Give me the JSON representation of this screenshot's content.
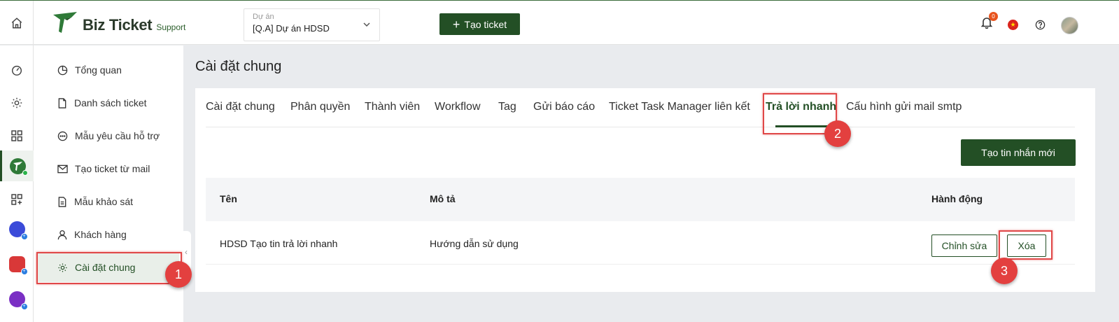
{
  "app": {
    "name": "Biz Ticket",
    "sub": "Support"
  },
  "project": {
    "label": "Dự án",
    "value": "[Q.A] Dự án HDSD"
  },
  "header": {
    "create_ticket": "Tạo ticket",
    "notification_count": "0"
  },
  "sidebar": {
    "items": [
      {
        "label": "Tổng quan",
        "icon": "pie-chart-icon"
      },
      {
        "label": "Danh sách ticket",
        "icon": "file-icon"
      },
      {
        "label": "Mẫu yêu cầu hỗ trợ",
        "icon": "chat-icon"
      },
      {
        "label": "Tạo ticket từ mail",
        "icon": "mail-icon"
      },
      {
        "label": "Mẫu khảo sát",
        "icon": "document-icon"
      },
      {
        "label": "Khách hàng",
        "icon": "user-icon"
      },
      {
        "label": "Cài đặt chung",
        "icon": "gear-icon",
        "active": true
      }
    ]
  },
  "page": {
    "title": "Cài đặt chung"
  },
  "tabs": [
    "Cài đặt chung",
    "Phân quyền",
    "Thành viên",
    "Workflow",
    "Tag",
    "Gửi báo cáo",
    "Ticket Task Manager liên kết",
    "Trả lời nhanh",
    "Cấu hình gửi mail smtp"
  ],
  "active_tab": "Trả lời nhanh",
  "actions": {
    "new_message": "Tạo tin nhắn mới"
  },
  "table": {
    "headers": {
      "name": "Tên",
      "description": "Mô tả",
      "actions": "Hành động"
    },
    "rows": [
      {
        "name": "HDSD Tạo tin trả lời nhanh",
        "description": "Hướng dẫn sử dụng",
        "edit": "Chỉnh sửa",
        "delete": "Xóa"
      }
    ]
  },
  "annotations": [
    "1",
    "2",
    "3"
  ],
  "colors": {
    "brand": "#234f25",
    "highlight": "#e04848",
    "marker": "#e3403f"
  }
}
